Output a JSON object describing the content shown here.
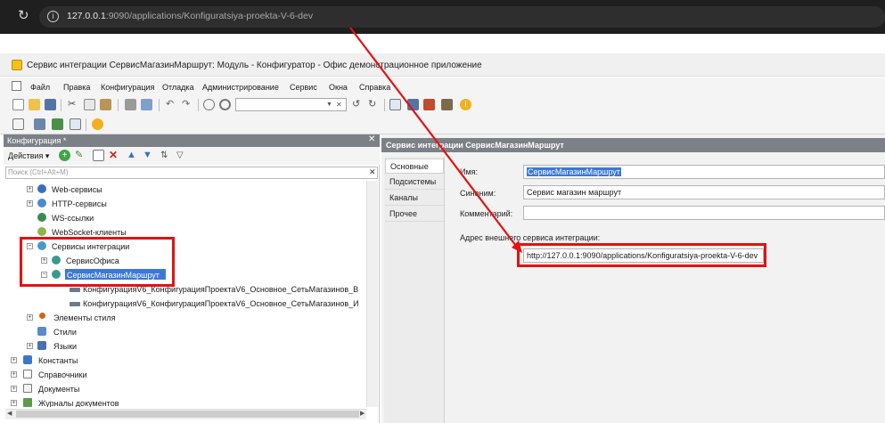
{
  "browser": {
    "url_host": "127.0.0.1",
    "url_rest": ":9090/applications/Konfiguratsiya-proekta-V-6-dev"
  },
  "window": {
    "title": "Сервис интеграции СервисМагазинМаршрут: Модуль - Конфигуратор - Офис демонстрационное приложение"
  },
  "menu": [
    "Файл",
    "Правка",
    "Конфигурация",
    "Отладка",
    "Администрирование",
    "Сервис",
    "Окна",
    "Справка"
  ],
  "left_panel": {
    "title": "Конфигурация *",
    "actions_label": "Действия ▾",
    "search_placeholder": "Поиск (Ctrl+Alt+M)",
    "tree": [
      "Web-сервисы",
      "HTTP-сервисы",
      "WS-ссылки",
      "WebSocket-клиенты",
      "Сервисы интеграции",
      "СервисОфиса",
      "СервисМагазинМаршрут",
      "КонфигурацияV6_КонфигурацияПроектаV6_Основное_СетьМагазинов_В",
      "КонфигурацияV6_КонфигурацияПроектаV6_Основное_СетьМагазинов_И",
      "Элементы стиля",
      "Стили",
      "Языки",
      "Константы",
      "Справочники",
      "Документы",
      "Журналы документов"
    ]
  },
  "right_panel": {
    "title": "Сервис интеграции СервисМагазинМаршрут",
    "tabs": [
      "Основные",
      "Подсистемы",
      "Каналы",
      "Прочее"
    ],
    "name_label": "Имя:",
    "name_value": "СервисМагазинМаршрут",
    "synonym_label": "Синоним:",
    "synonym_value": "Сервис магазин маршрут",
    "comment_label": "Комментарий:",
    "comment_value": "",
    "address_label": "Адрес внешнего сервиса интеграции:",
    "address_value": "http://127.0.0.1:9090/applications/Konfiguratsiya-proekta-V-6-dev"
  },
  "colors": {
    "annotation": "#e21212",
    "selection": "#3b78d8",
    "panel_header": "#7c8087"
  }
}
